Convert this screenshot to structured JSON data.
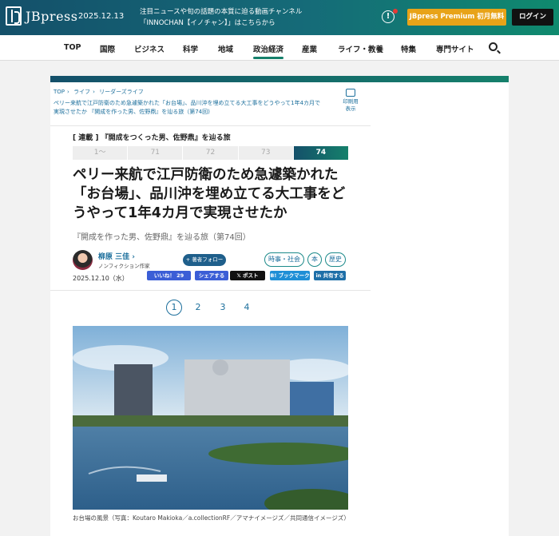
{
  "header": {
    "logo_text": "JBpress",
    "date": "2025.12.13",
    "promo_line1": "注目ニュースや旬の話題の本質に迫る動画チャンネル",
    "promo_line2": "「INNOCHAN【イノチャン】」はこちらから",
    "info_icon": "info-icon",
    "premium_label": "JBpress Premium 初月無料",
    "login_label": "ログイン",
    "colors": {
      "brand_start": "#14506a",
      "brand_end": "#0f8a6e",
      "premium": "#e8a318"
    }
  },
  "nav": {
    "items": [
      "TOP",
      "国際",
      "ビジネス",
      "科学",
      "地域",
      "政治経済",
      "産業",
      "ライフ・教養",
      "特集",
      "専門サイト"
    ],
    "active": "政治経済",
    "search_icon": "search-icon"
  },
  "breadcrumb": {
    "items": [
      "TOP",
      "ライフ",
      "リーダーズライフ"
    ],
    "title": "ペリー来航で江戸防衛のため急遽築かれた「お台場」、品川沖を埋め立てる大工事をどうやって1年4カ月で実現させたか 『開成を作った男、佐野鼎』を辿る旅（第74回)",
    "print_label_line1": "印刷用",
    "print_label_line2": "表示"
  },
  "article": {
    "series": "[ 連載 ] 『開成をつくった男、佐野鼎』を辿る旅",
    "series_tabs": [
      "1～",
      "71",
      "72",
      "73",
      "74"
    ],
    "series_active": "74",
    "headline": "ペリー来航で江戸防衛のため急遽築かれた「お台場」、品川沖を埋め立てる大工事をどうやって1年4カ月で実現させたか",
    "subtitle": "『開成を作った男、佐野鼎』を辿る旅（第74回）",
    "author": {
      "name": "柳原 三佳",
      "role": "ノンフィクション作家",
      "follow_label": "著者フォロー"
    },
    "tags": [
      "時事・社会",
      "本",
      "歴史"
    ],
    "date": "2025.12.10（水）",
    "share": {
      "like": "いいね！ 29",
      "facebook": "シェアする",
      "x": "ポスト",
      "hatena": "ブックマーク",
      "linkedin": "共有する"
    },
    "pages": [
      "1",
      "2",
      "3",
      "4"
    ],
    "current_page": "1",
    "caption": "お台場の風景（写真：Koutaro Makioka／a.collectionRF／アマナイメージズ／共同通信イメージズ）"
  }
}
